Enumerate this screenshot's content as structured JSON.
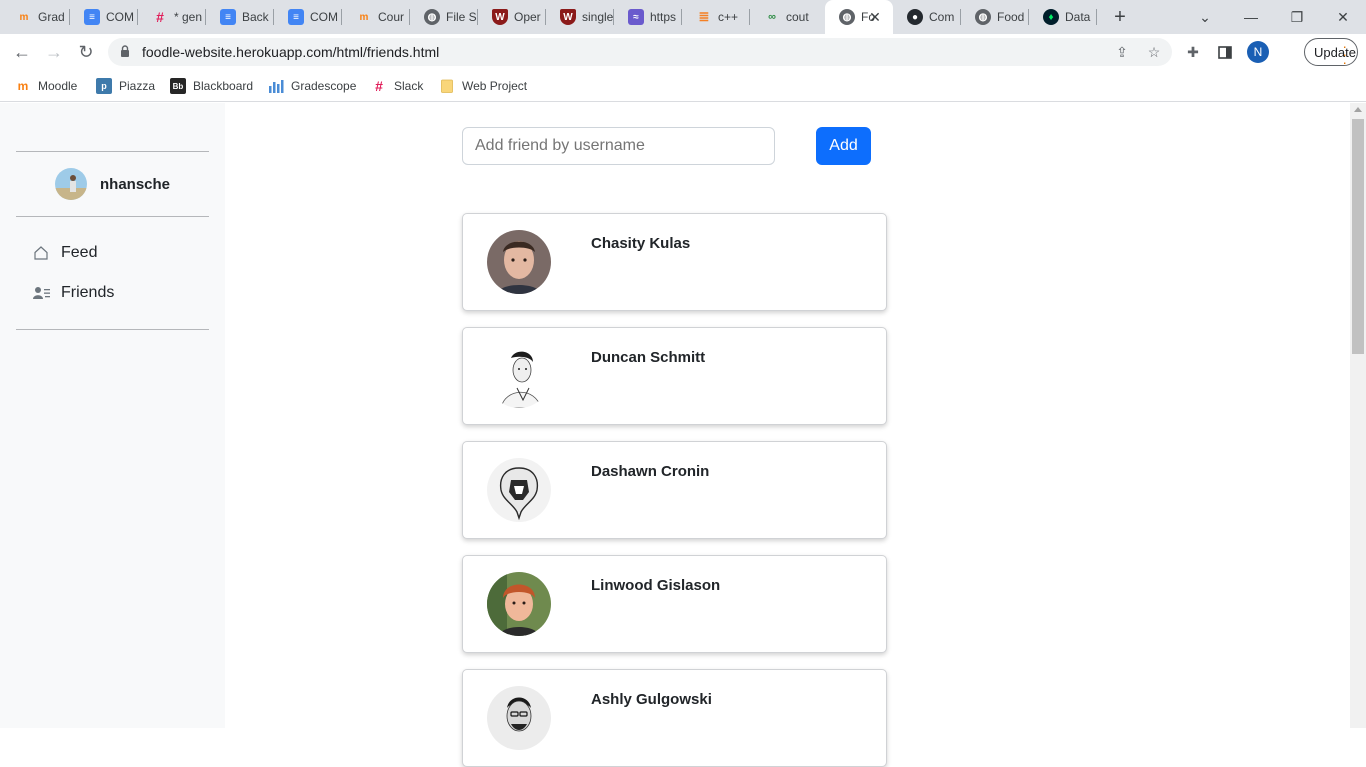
{
  "browser": {
    "tabs": [
      {
        "title": "Grad",
        "icon": "moodle-icon"
      },
      {
        "title": "COM",
        "icon": "google-docs-icon"
      },
      {
        "title": "* gen",
        "icon": "slack-icon"
      },
      {
        "title": "Back",
        "icon": "google-docs-icon"
      },
      {
        "title": "COM",
        "icon": "google-docs-icon"
      },
      {
        "title": "Cour",
        "icon": "moodle-icon"
      },
      {
        "title": "File S",
        "icon": "globe-icon"
      },
      {
        "title": "Oper",
        "icon": "shield-crest-icon"
      },
      {
        "title": "single",
        "icon": "shield-crest-icon"
      },
      {
        "title": "https",
        "icon": "wave-icon"
      },
      {
        "title": "c++",
        "icon": "stackoverflow-icon"
      },
      {
        "title": "cout",
        "icon": "geeksforgeeks-icon"
      },
      {
        "title": "Fo",
        "icon": "globe-icon"
      },
      {
        "title": "Com",
        "icon": "github-icon"
      },
      {
        "title": "Food",
        "icon": "globe-icon"
      },
      {
        "title": "Data",
        "icon": "mongodb-icon"
      }
    ],
    "active_tab_index": 12,
    "url": "foodle-website.herokuapp.com/html/friends.html",
    "profile_initial": "N",
    "update_label": "Update",
    "bookmarks": [
      {
        "label": "Moodle",
        "icon": "moodle-icon"
      },
      {
        "label": "Piazza",
        "icon": "piazza-icon"
      },
      {
        "label": "Blackboard",
        "icon": "blackboard-icon"
      },
      {
        "label": "Gradescope",
        "icon": "gradescope-icon"
      },
      {
        "label": "Slack",
        "icon": "slack-icon"
      },
      {
        "label": "Web Project",
        "icon": "folder-icon"
      }
    ]
  },
  "sidebar": {
    "username": "nhansche",
    "nav": [
      {
        "label": "Feed",
        "icon": "home-icon"
      },
      {
        "label": "Friends",
        "icon": "friends-icon"
      }
    ]
  },
  "main": {
    "add_friend_placeholder": "Add friend by username",
    "add_button_label": "Add",
    "friends": [
      {
        "name": "Chasity Kulas"
      },
      {
        "name": "Duncan Schmitt"
      },
      {
        "name": "Dashawn Cronin"
      },
      {
        "name": "Linwood Gislason"
      },
      {
        "name": "Ashly Gulgowski"
      }
    ]
  },
  "colors": {
    "accent": "#0d6efd",
    "sidebar_bg": "#f8f9fa"
  }
}
